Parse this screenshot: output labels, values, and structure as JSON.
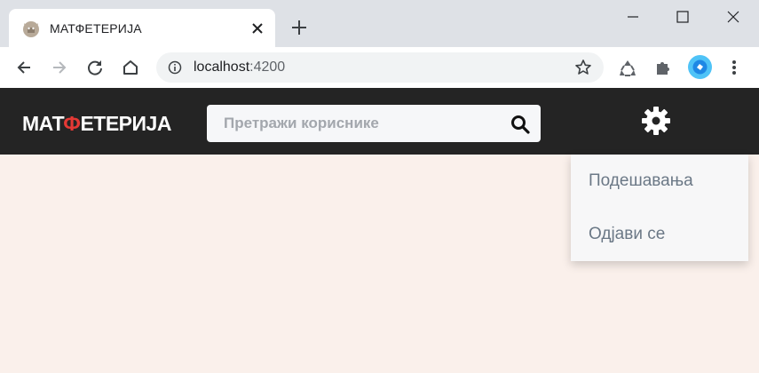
{
  "browser": {
    "tab": {
      "title": "МАТФЕТЕРИЈА",
      "favicon": "cat-favicon-icon",
      "close_icon": "close-icon"
    },
    "new_tab_icon": "plus-icon",
    "window_controls": [
      "minimize-icon",
      "maximize-icon",
      "close-icon"
    ],
    "toolbar": {
      "back_icon": "arrow-left-icon",
      "forward_icon": "arrow-right-icon",
      "reload_icon": "reload-icon",
      "home_icon": "home-icon",
      "url_host": "localhost",
      "url_port": ":4200",
      "bookmark_icon": "star-icon",
      "extensions": [
        "recycle-icon",
        "puzzle-icon"
      ],
      "profile_icon": "profile-avatar-icon",
      "menu_icon": "vertical-dots-icon"
    }
  },
  "header": {
    "logo": {
      "part1": "МАТ",
      "accent": "Ф",
      "part2": "ЕТЕРИЈА"
    },
    "search": {
      "placeholder": "Претражи кориснике",
      "icon": "search-icon"
    },
    "settings_icon": "gear-icon"
  },
  "dropdown": {
    "items": [
      {
        "label": "Подешавања"
      },
      {
        "label": "Одјави се"
      }
    ]
  },
  "colors": {
    "header_bg": "#242424",
    "page_bg": "#faf0eb",
    "logo_accent": "#e53935",
    "dropdown_text": "#6b7886"
  }
}
